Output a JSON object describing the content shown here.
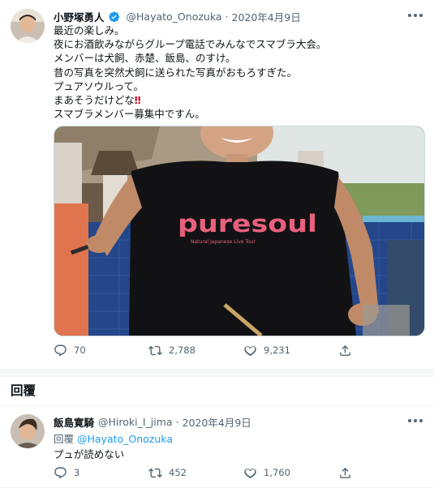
{
  "tweet": {
    "author_name": "小野塚勇人",
    "handle": "@Hayato_Onozuka",
    "separator": "·",
    "date": "2020年4月9日",
    "lines": [
      "最近の楽しみ。",
      "夜にお酒飲みながらグループ電話でみんなでスマブラ大会。",
      "メンバーは犬飼、赤楚、飯島、のすけ。",
      "昔の写真を突然犬飼に送られた写真がおもろすぎた。",
      "プュアソウルって。",
      "まあそうだけどな",
      "スマブラメンバー募集中ですん。"
    ],
    "emphasis": "‼",
    "shirt_print": "puresoul",
    "shirt_subtext": "Natural Japanese Live Tour",
    "stats": {
      "replies": "70",
      "retweets": "2,788",
      "likes": "9,231"
    }
  },
  "section": {
    "title": "回覆"
  },
  "reply": {
    "author_name": "飯島寛騎",
    "handle": "@Hiroki_I_jima",
    "separator": "·",
    "date": "2020年4月9日",
    "replying_label": "回覆",
    "replying_to": "@Hayato_Onozuka",
    "text": "プュが読めない",
    "stats": {
      "replies": "3",
      "retweets": "452",
      "likes": "1,760"
    }
  },
  "icons": {
    "verified": "verified-badge-icon",
    "more": "more-icon",
    "reply": "reply-icon",
    "retweet": "retweet-icon",
    "like": "like-icon",
    "share": "share-icon"
  },
  "colors": {
    "accent": "#1d9bf0",
    "secondary_text": "#536471",
    "emphasis": "#d0021b",
    "shirt_print": "#e8607e"
  }
}
